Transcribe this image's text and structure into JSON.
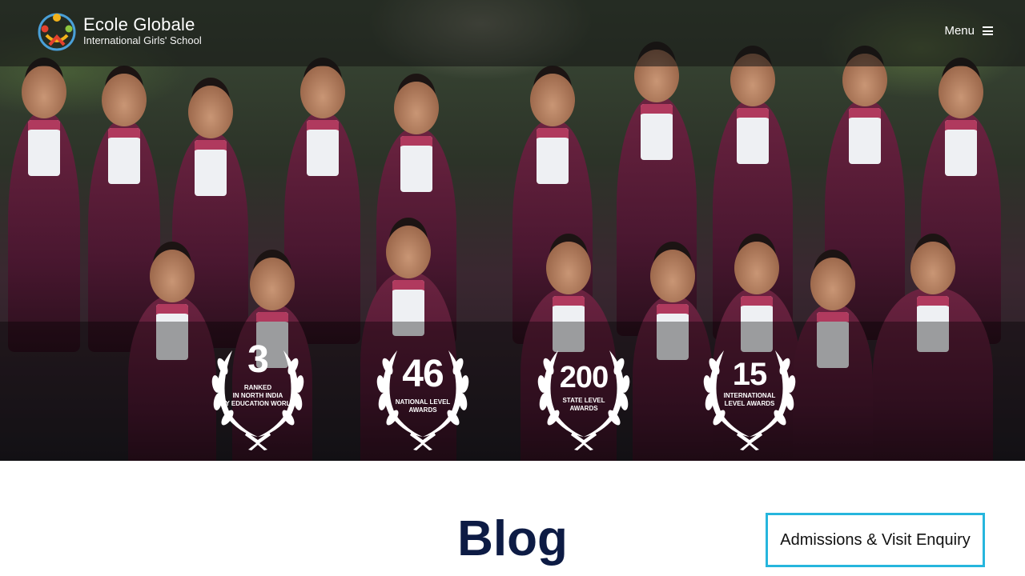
{
  "header": {
    "logo_name": "Ecole Globale",
    "logo_subtitle": "International Girls' School",
    "menu_label": "Menu"
  },
  "awards": [
    {
      "number": "3",
      "line1": "RANKED",
      "line2": "IN NORTH INDIA",
      "line3": "BY EDUCATION WORLD"
    },
    {
      "number": "46",
      "line1": "NATIONAL LEVEL",
      "line2": "AWARDS",
      "line3": ""
    },
    {
      "number": "200",
      "line1": "STATE LEVEL",
      "line2": "AWARDS",
      "line3": ""
    },
    {
      "number": "15",
      "line1": "INTERNATIONAL",
      "line2": "LEVEL AWARDS",
      "line3": ""
    }
  ],
  "content": {
    "title": "Blog",
    "enquiry_button": "Admissions & Visit Enquiry"
  },
  "colors": {
    "title": "#0d1b44",
    "enquiry_border": "#26b6dd",
    "uniform": "#5a1c35"
  }
}
